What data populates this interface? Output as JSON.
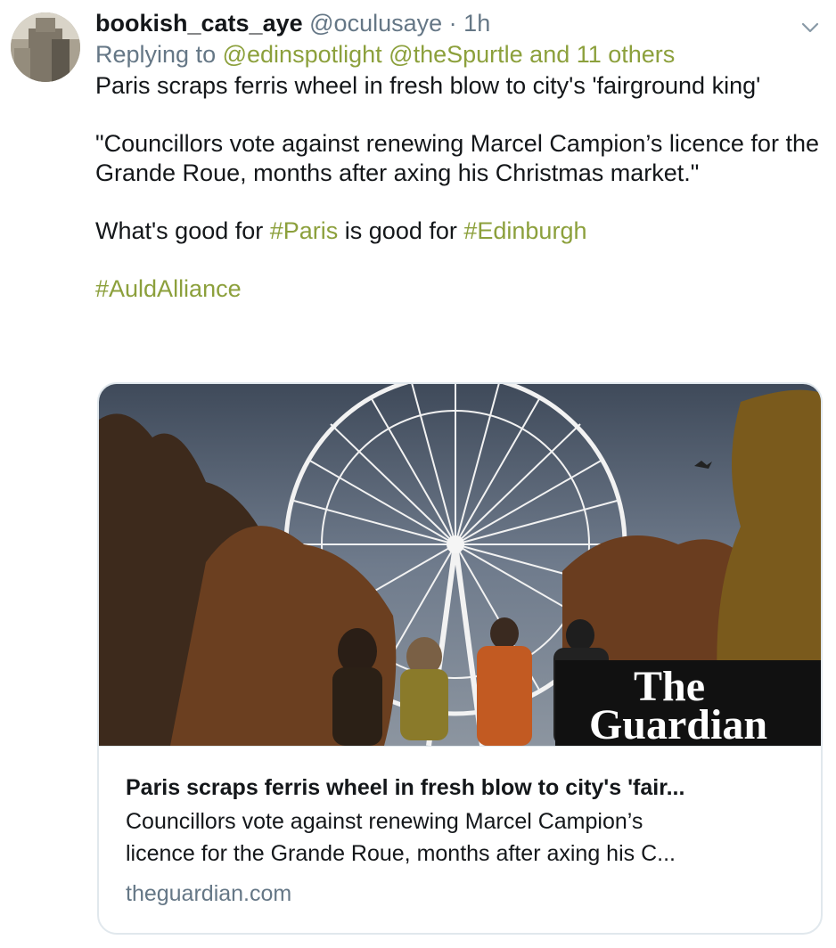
{
  "tweet": {
    "author": {
      "display_name": "bookish_cats_aye",
      "handle": "@oculusaye",
      "separator": "·",
      "time": "1h"
    },
    "reply": {
      "prefix": "Replying to",
      "mentions": [
        "@edinspotlight",
        "@theSpurtle"
      ],
      "others": "and 11 others"
    },
    "text": {
      "line1": "Paris scraps ferris wheel in fresh blow to city's 'fairground king'",
      "quote": "\"Councillors vote against renewing Marcel Campion’s licence for the Grande Roue, months after axing his Christmas market.\"",
      "line3_prefix": "What's good for ",
      "hashtag_paris": "#Paris",
      "line3_middle": " is good for ",
      "hashtag_edinburgh": "#Edinburgh",
      "hashtag_auld": "#AuldAlliance"
    },
    "card": {
      "image_logo_line1": "The",
      "image_logo_line2": "Guardian",
      "title": "Paris scraps ferris wheel in fresh blow to city's 'fair...",
      "description_line1": "Councillors vote against renewing Marcel Campion’s",
      "description_line2": "licence for the Grande Roue, months after axing his C...",
      "domain": "theguardian.com"
    }
  },
  "icons": {
    "caret": "chevron-down-icon",
    "avatar": "avatar"
  },
  "colors": {
    "link": "#8ca03c",
    "secondary_text": "#657786",
    "primary_text": "#14171a",
    "card_border": "#e1e8ed"
  }
}
